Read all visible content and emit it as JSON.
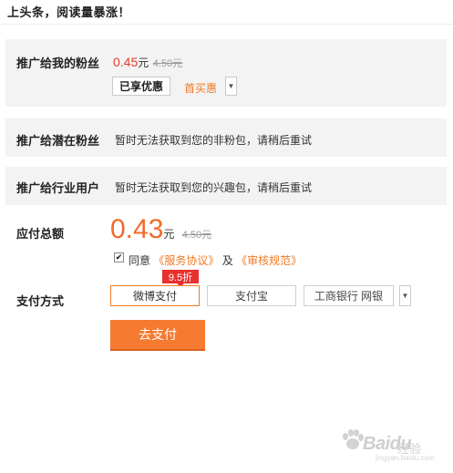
{
  "header": {
    "title": "上头条，阅读量暴涨！"
  },
  "fans": {
    "label": "推广给我的粉丝",
    "price": "0.45",
    "unit": "元",
    "original_price": "4.50元",
    "tag_selected": "已享优惠",
    "tag_first_buy": "首买惠"
  },
  "potential": {
    "label": "推广给潜在粉丝",
    "note": "暂时无法获取到您的非粉包，请稍后重试"
  },
  "industry": {
    "label": "推广给行业用户",
    "note": "暂时无法获取到您的兴趣包，请稍后重试"
  },
  "total": {
    "label": "应付总额",
    "price": "0.43",
    "unit": "元",
    "original_price": "4.50元",
    "agree_text": "同意",
    "service_link": "《服务协议》",
    "and_text": "及",
    "review_link": "《审核规范》",
    "agreed": true
  },
  "payment": {
    "label": "支付方式",
    "discount_badge": "9.5折",
    "options": [
      "微博支付",
      "支付宝",
      "工商银行 网银"
    ],
    "selected_index": 0,
    "submit_label": "去支付"
  },
  "watermark": {
    "brand": "Bai",
    "brand_tail": "du",
    "sub": "经验",
    "url": "jingyan.baidu.com"
  },
  "icons": {
    "dropdown": "chevron-down-icon",
    "check": "check-icon",
    "paw": "paw-icon"
  },
  "colors": {
    "accent": "#f67a30",
    "price_red": "#e53b2c",
    "badge_red": "#e8312d",
    "link_orange": "#f07a22"
  }
}
